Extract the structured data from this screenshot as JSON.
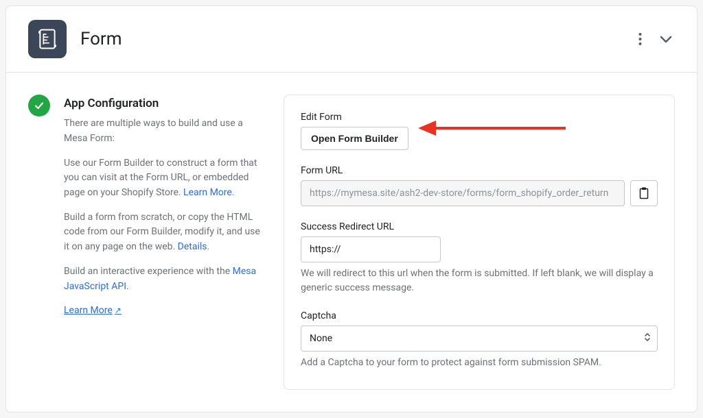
{
  "header": {
    "title": "Form"
  },
  "sidebar": {
    "heading": "App Configuration",
    "intro": "There are multiple ways to build and use a Mesa Form:",
    "p1_pre": "Use our Form Builder to construct a form that you can visit at the Form URL, or embedded page on your Shopify Store. ",
    "p1_link": "Learn More",
    "p2_pre": "Build a form from scratch, or copy the HTML code from our Form Builder, modify it, and use it on any page on the web. ",
    "p2_link": "Details",
    "p3_pre": "Build an interactive experience with the ",
    "p3_link": "Mesa JavaScript API",
    "learn_more": "Learn More"
  },
  "form": {
    "edit_form_label": "Edit Form",
    "open_builder_btn": "Open Form Builder",
    "form_url_label": "Form URL",
    "form_url_value": "https://mymesa.site/ash2-dev-store/forms/form_shopify_order_return",
    "success_url_label": "Success Redirect URL",
    "success_url_value": "https://",
    "success_help": "We will redirect to this url when the form is submitted. If left blank, we will display a generic success message.",
    "captcha_label": "Captcha",
    "captcha_value": "None",
    "captcha_help": "Add a Captcha to your form to protect against form submission SPAM."
  }
}
